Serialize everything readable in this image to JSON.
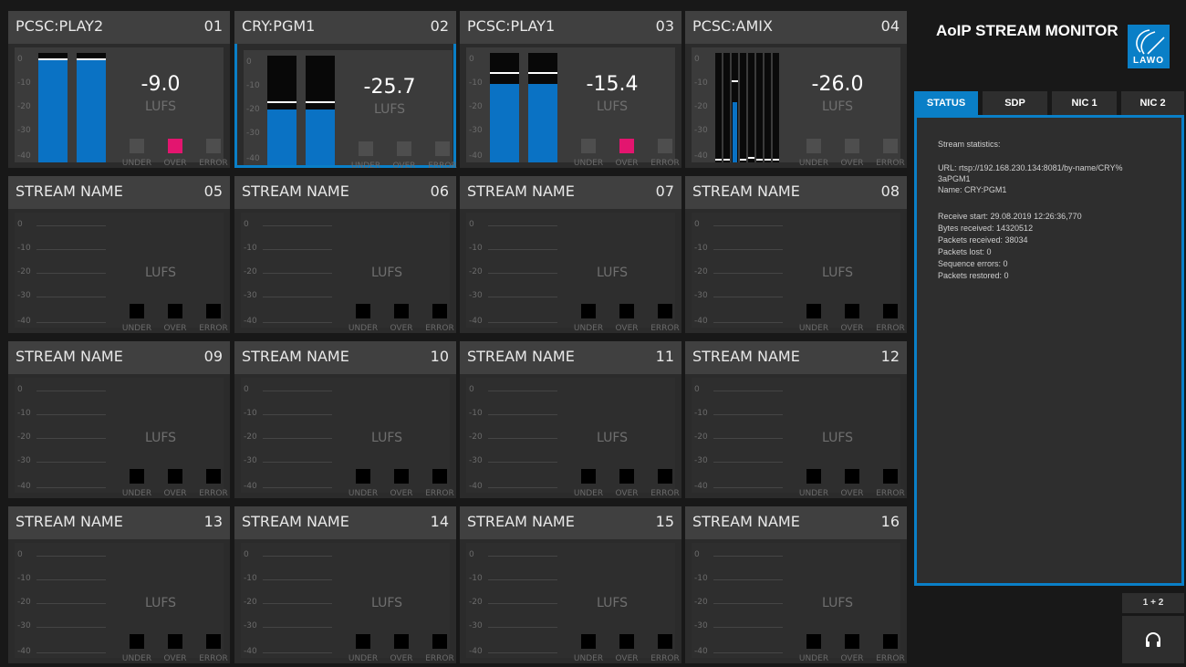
{
  "monitor": {
    "title": "AoIP STREAM MONITOR",
    "logo_text": "LAWO"
  },
  "scale_labels": [
    "0",
    "-10",
    "-20",
    "-30",
    "-40"
  ],
  "indicator_labels": [
    "UNDER",
    "OVER",
    "ERROR"
  ],
  "streams": [
    {
      "name": "PCSC:PLAY2",
      "num": "01",
      "value": "-9.0",
      "unit": "LUFS",
      "active": true,
      "selected": false,
      "meter": "bars",
      "levels": [
        0.93,
        0.93
      ],
      "peaks": [
        0.93,
        0.93
      ],
      "indicators": {
        "under": false,
        "over": true,
        "error": false
      }
    },
    {
      "name": "CRY:PGM1",
      "num": "02",
      "value": "-25.7",
      "unit": "LUFS",
      "active": true,
      "selected": true,
      "meter": "bars",
      "levels": [
        0.51,
        0.51
      ],
      "peaks": [
        0.57,
        0.57
      ],
      "indicators": {
        "under": false,
        "over": false,
        "error": false
      }
    },
    {
      "name": "PCSC:PLAY1",
      "num": "03",
      "value": "-15.4",
      "unit": "LUFS",
      "active": true,
      "selected": false,
      "meter": "bars",
      "levels": [
        0.72,
        0.72
      ],
      "peaks": [
        0.81,
        0.81
      ],
      "indicators": {
        "under": false,
        "over": true,
        "error": false
      }
    },
    {
      "name": "PCSC:AMIX",
      "num": "04",
      "value": "-26.0",
      "unit": "LUFS",
      "active": true,
      "selected": false,
      "meter": "segments",
      "levels": [
        0,
        0,
        0.55,
        0,
        0,
        0,
        0,
        0
      ],
      "peaks": [
        0.02,
        0.02,
        0.73,
        0.02,
        0.03,
        0.02,
        0.02,
        0.02
      ],
      "indicators": {
        "under": false,
        "over": false,
        "error": false
      }
    },
    {
      "name": "STREAM NAME",
      "num": "05",
      "value": "",
      "unit": "LUFS",
      "active": false
    },
    {
      "name": "STREAM NAME",
      "num": "06",
      "value": "",
      "unit": "LUFS",
      "active": false
    },
    {
      "name": "STREAM NAME",
      "num": "07",
      "value": "",
      "unit": "LUFS",
      "active": false
    },
    {
      "name": "STREAM NAME",
      "num": "08",
      "value": "",
      "unit": "LUFS",
      "active": false
    },
    {
      "name": "STREAM NAME",
      "num": "09",
      "value": "",
      "unit": "LUFS",
      "active": false
    },
    {
      "name": "STREAM NAME",
      "num": "10",
      "value": "",
      "unit": "LUFS",
      "active": false
    },
    {
      "name": "STREAM NAME",
      "num": "11",
      "value": "",
      "unit": "LUFS",
      "active": false
    },
    {
      "name": "STREAM NAME",
      "num": "12",
      "value": "",
      "unit": "LUFS",
      "active": false
    },
    {
      "name": "STREAM NAME",
      "num": "13",
      "value": "",
      "unit": "LUFS",
      "active": false
    },
    {
      "name": "STREAM NAME",
      "num": "14",
      "value": "",
      "unit": "LUFS",
      "active": false
    },
    {
      "name": "STREAM NAME",
      "num": "15",
      "value": "",
      "unit": "LUFS",
      "active": false
    },
    {
      "name": "STREAM NAME",
      "num": "16",
      "value": "",
      "unit": "LUFS",
      "active": false
    }
  ],
  "tabs": [
    {
      "label": "STATUS",
      "active": true
    },
    {
      "label": "SDP",
      "active": false
    },
    {
      "label": "NIC 1",
      "active": false
    },
    {
      "label": "NIC 2",
      "active": false
    }
  ],
  "status": {
    "heading": "Stream statistics:",
    "url_line1": "URL: rtsp://192.168.230.134:8081/by-name/CRY%",
    "url_line2": "3aPGM1",
    "name": "Name: CRY:PGM1",
    "receive_start": "Receive start: 29.08.2019 12:26:36,770",
    "bytes_received": "Bytes received: 14320512",
    "packets_received": "Packets received: 38034",
    "packets_lost": "Packets lost: 0",
    "sequence_errors": "Sequence errors: 0",
    "packets_restored": "Packets restored: 0"
  },
  "channel_button": "1 + 2",
  "colors": {
    "accent": "#0a7fc7",
    "meter": "#0a72c4",
    "over": "#e3156f"
  }
}
